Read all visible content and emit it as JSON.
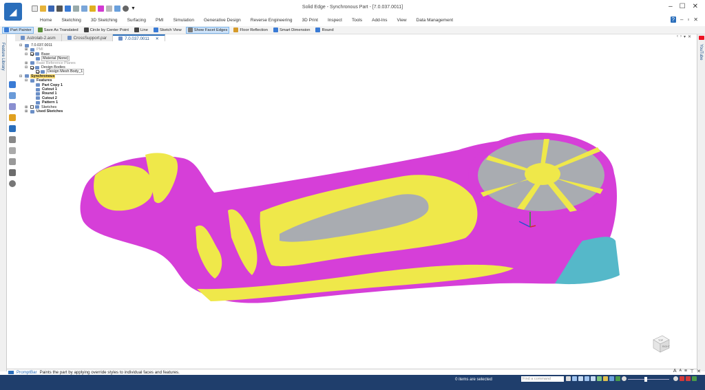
{
  "window": {
    "title": "Solid Edge - Synchronous Part - [7.0.037.0011]",
    "controls": [
      "–",
      "☐",
      "✕"
    ]
  },
  "ribbon": {
    "tabs": [
      "Home",
      "Sketching",
      "3D Sketching",
      "Surfacing",
      "PMI",
      "Simulation",
      "Generative Design",
      "Reverse Engineering",
      "3D Print",
      "Inspect",
      "Tools",
      "Add-Ins",
      "View",
      "Data Management"
    ]
  },
  "command_bar": {
    "items": [
      {
        "label": "Part Painter",
        "active": true,
        "color": "#3a7bd5"
      },
      {
        "label": "Save As Translated",
        "active": false,
        "color": "#5b8f3a"
      },
      {
        "label": "Circle by Center Point",
        "active": false,
        "color": "#444"
      },
      {
        "label": "Line",
        "active": false,
        "color": "#444"
      },
      {
        "label": "Sketch View",
        "active": false,
        "color": "#3a7bd5"
      },
      {
        "label": "Show Facet Edges",
        "active": true,
        "color": "#7a7a7a"
      },
      {
        "label": "Floor Reflection",
        "active": false,
        "color": "#d59a2a"
      },
      {
        "label": "Smart Dimension",
        "active": false,
        "color": "#3a7bd5"
      },
      {
        "label": "Round",
        "active": false,
        "color": "#3a7bd5"
      }
    ]
  },
  "document_tabs": [
    {
      "label": "Astrolab-2.asm",
      "active": false
    },
    {
      "label": "CrossSupport.par",
      "active": false
    },
    {
      "label": "7.0.037.0011",
      "active": true
    }
  ],
  "left_strip": {
    "label": "Feature Library"
  },
  "right_strip": {
    "label": "YouTube"
  },
  "tree": {
    "nodes": [
      {
        "label": "7.0.037.0011",
        "indent": 0,
        "expander": "⊟",
        "style": ""
      },
      {
        "label": "PMI",
        "indent": 1,
        "expander": "⊞",
        "style": "gray"
      },
      {
        "label": "Base",
        "indent": 1,
        "expander": "⊟",
        "style": "",
        "checked": true
      },
      {
        "label": "Material (None)",
        "indent": 2,
        "expander": "",
        "style": "boxed"
      },
      {
        "label": "Base Reference Planes",
        "indent": 1,
        "expander": "⊞",
        "style": "gray"
      },
      {
        "label": "Design Bodies",
        "indent": 1,
        "expander": "⊟",
        "style": "",
        "checked": true
      },
      {
        "label": "Design Mesh Body_1",
        "indent": 2,
        "expander": "",
        "style": "boxed",
        "checked": true
      },
      {
        "label": "Synchronous",
        "indent": 0,
        "expander": "⊟",
        "style": "hl"
      },
      {
        "label": "Features",
        "indent": 1,
        "expander": "⊟",
        "style": "bold"
      },
      {
        "label": "Part Copy 1",
        "indent": 2,
        "expander": "",
        "style": "bold"
      },
      {
        "label": "Cutout 1",
        "indent": 2,
        "expander": "",
        "style": "bold"
      },
      {
        "label": "Round 1",
        "indent": 2,
        "expander": "",
        "style": "bold"
      },
      {
        "label": "Cutout 2",
        "indent": 2,
        "expander": "",
        "style": "bold"
      },
      {
        "label": "Pattern 1",
        "indent": 2,
        "expander": "",
        "style": "bold"
      },
      {
        "label": "Sketches",
        "indent": 1,
        "expander": "⊞",
        "style": "",
        "checked": false
      },
      {
        "label": "Used Sketches",
        "indent": 1,
        "expander": "⊞",
        "style": "bold"
      }
    ]
  },
  "prompt_bar": {
    "name": "PromptBar",
    "message": "Paints the part by applying override styles to individual faces and features."
  },
  "status_bar": {
    "selection": "0 items are selected",
    "find_placeholder": "Find a command"
  },
  "view_cube": {
    "faces": [
      "TOP",
      "RIGHT"
    ]
  },
  "colors": {
    "magenta": "#d63fd8",
    "yellow": "#efe84a",
    "cyan": "#55b8c9",
    "gray": "#a9acb1",
    "status_bg": "#1f3e6c"
  }
}
